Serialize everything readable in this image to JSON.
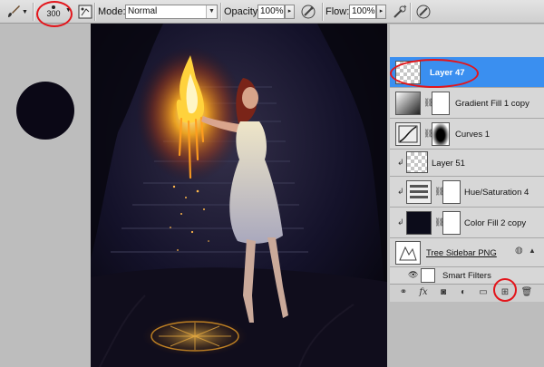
{
  "options_bar": {
    "brush_size": "300",
    "mode_label": "Mode:",
    "mode_value": "Normal",
    "opacity_label": "Opacity:",
    "opacity_value": "100%",
    "flow_label": "Flow:",
    "flow_value": "100%"
  },
  "layers": [
    {
      "name": "Layer 47",
      "selected": true
    },
    {
      "name": "Gradient Fill 1 copy"
    },
    {
      "name": "Curves 1"
    },
    {
      "name": "Layer 51"
    },
    {
      "name": "Hue/Saturation 4"
    },
    {
      "name": "Color Fill 2 copy"
    },
    {
      "name": "Tree Sidebar PNG"
    },
    {
      "name": "Smart Filters"
    }
  ],
  "footer_icons": [
    "link-icon",
    "fx-icon",
    "mask-icon",
    "adjustment-icon",
    "folder-icon",
    "new-layer-icon",
    "trash-icon"
  ],
  "colors": {
    "highlight": "#e3151b",
    "selection": "#3a8ff0",
    "canvas_bg": "#0b0a19"
  }
}
